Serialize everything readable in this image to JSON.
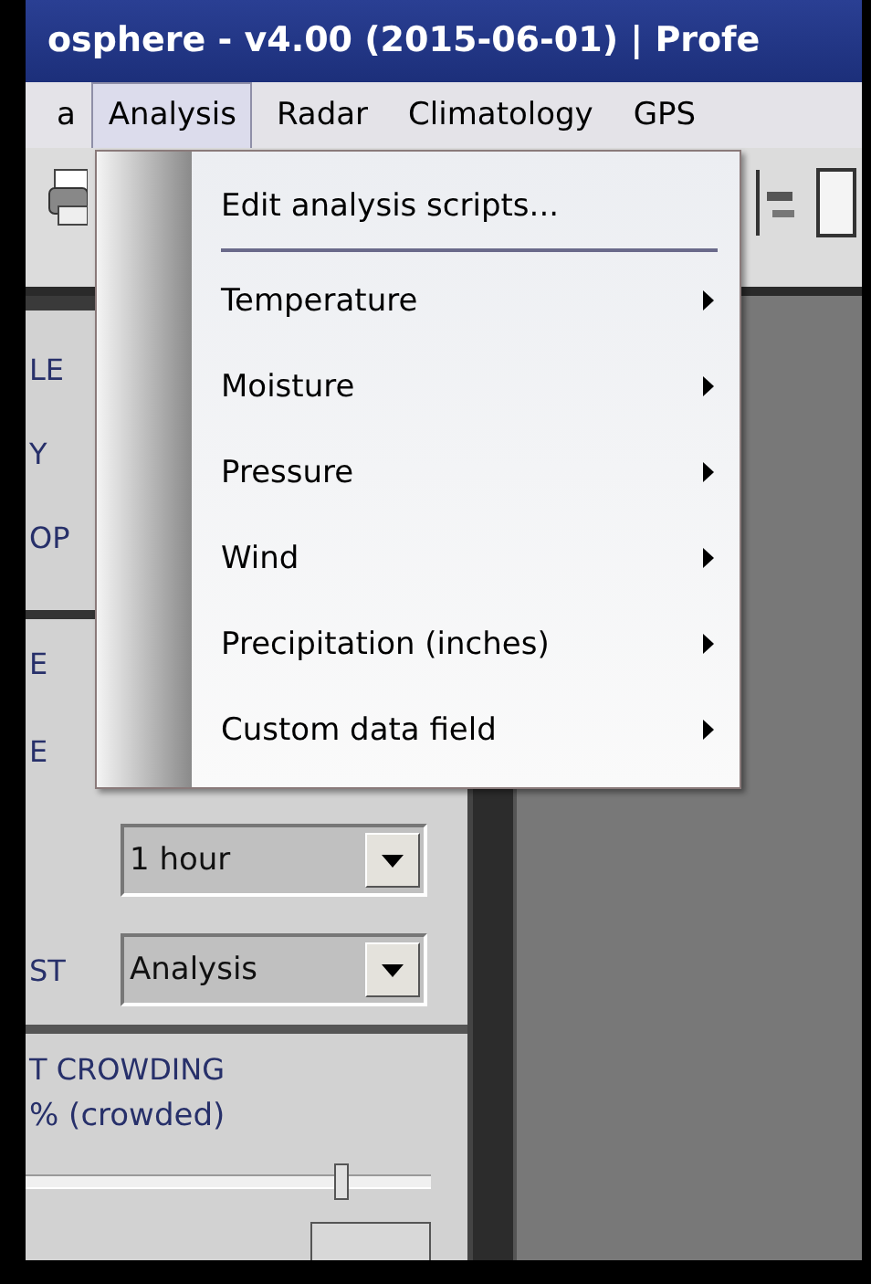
{
  "window": {
    "title": "osphere - v4.00 (2015-06-01) | Profe"
  },
  "menubar": {
    "items": [
      {
        "label": "a",
        "selected": false
      },
      {
        "label": "Analysis",
        "selected": true
      },
      {
        "label": "Radar",
        "selected": false
      },
      {
        "label": "Climatology",
        "selected": false
      },
      {
        "label": "GPS",
        "selected": false
      }
    ]
  },
  "side_panel": {
    "labels_top": [
      "LE",
      "Y",
      "OP"
    ],
    "section_2": {
      "label_1": "E",
      "label_2": "E",
      "combo_1": {
        "value": "1 hour"
      },
      "combo_2_label": "ST",
      "combo_2": {
        "value": "Analysis"
      }
    },
    "crowding": {
      "title": "T CROWDING",
      "reading": "% (crowded)",
      "level": 0.78
    }
  },
  "dropdown": {
    "items": [
      {
        "kind": "command",
        "label": "Edit analysis scripts..."
      },
      {
        "kind": "separator"
      },
      {
        "kind": "submenu",
        "label": "Temperature"
      },
      {
        "kind": "submenu",
        "label": "Moisture"
      },
      {
        "kind": "submenu",
        "label": "Pressure"
      },
      {
        "kind": "submenu",
        "label": "Wind"
      },
      {
        "kind": "submenu",
        "label": "Precipitation (inches)"
      },
      {
        "kind": "submenu",
        "label": "Custom data field"
      }
    ]
  }
}
